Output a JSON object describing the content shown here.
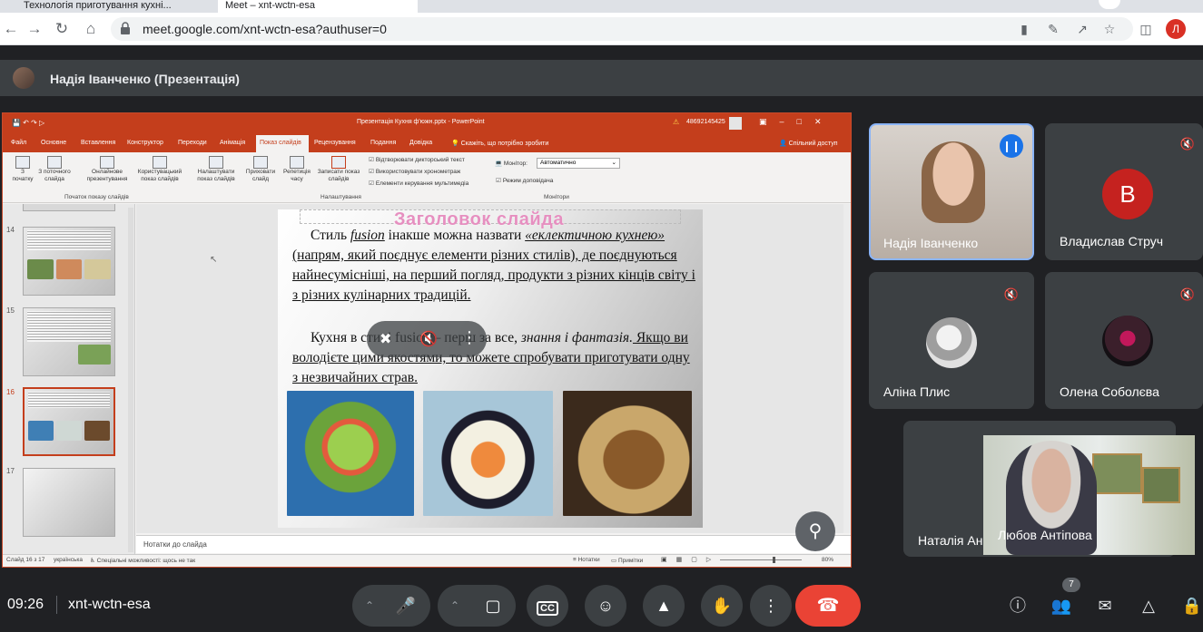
{
  "browser": {
    "tabs": [
      {
        "label": "Технологія приготування кухні..."
      },
      {
        "label": "Meet – xnt-wctn-esa"
      }
    ],
    "url": "meet.google.com/xnt-wctn-esa?authuser=0",
    "profile_initial": "Л"
  },
  "meet": {
    "presenter_label": "Надія Іванченко (Презентація)",
    "time": "09:26",
    "meeting_code": "xnt-wctn-esa",
    "participant_count": "7",
    "participants": [
      {
        "name": "Надія Іванченко",
        "speaking": true
      },
      {
        "name": "Владислав Струч",
        "initial": "В",
        "color": "#c5221f",
        "muted": true
      },
      {
        "name": "Аліна Плис",
        "muted": true
      },
      {
        "name": "Олена Соболєва",
        "muted": true
      },
      {
        "name": "Наталія Ан..."
      },
      {
        "name": "Любов Антіпова"
      }
    ]
  },
  "powerpoint": {
    "window_title": "Презентація Кухня ф'южн.pptx - PowerPoint",
    "account": "48692145425",
    "menu": [
      "Файл",
      "Основне",
      "Вставлення",
      "Конструктор",
      "Переходи",
      "Анімація",
      "Показ слайдів",
      "Рецензування",
      "Подання",
      "Довідка",
      "Скажіть, що потрібно зробити"
    ],
    "share_label": "Спільний доступ",
    "ribbon": {
      "buttons": [
        "З початку",
        "З поточного слайда",
        "Онлайнове презентування",
        "Користувацький показ слайдів",
        "Налаштувати показ слайдів",
        "Приховати слайд",
        "Репетиція часу",
        "Записати показ слайдів"
      ],
      "checkboxes": [
        "Відтворювати дикторський текст",
        "Використовувати хронометраж",
        "Елементи керування мультимедіа"
      ],
      "monitor_label": "Монітор:",
      "monitor_value": "Автоматично",
      "presenter_mode": "Режим доповідача",
      "groups": [
        "Початок показу слайдів",
        "Налаштування",
        "Монітори"
      ]
    },
    "thumbnails": [
      "14",
      "15",
      "16",
      "17"
    ],
    "slide": {
      "title": "Заголовок слайда",
      "p1_a": "Стиль ",
      "p1_fusion": "fusion",
      "p1_b": " інакше можна назвати ",
      "p1_quote": "«еклектичною кухнею»",
      "p1_c": " (напрям, який поєднує елементи різних стилів), де поєднуються найнесумісніші, на перший погляд, продукти з різних кінців світу і з різних кулінарних традицій.",
      "p2_a": "Кухня в стилі fusion – перш за все, ",
      "p2_em": "знання і фантазія.",
      "p2_b": " Якщо ви володієте цими якостями, то можете спробувати приготувати одну з незвичайних страв."
    },
    "notes_label": "Нотатки до слайда",
    "status": {
      "slide": "Слайд 16 з 17",
      "lang": "українська",
      "access": "Спеціальні можливості: щось не так",
      "notes": "Нотатки",
      "comments": "Примітки",
      "zoom": "80%"
    }
  }
}
